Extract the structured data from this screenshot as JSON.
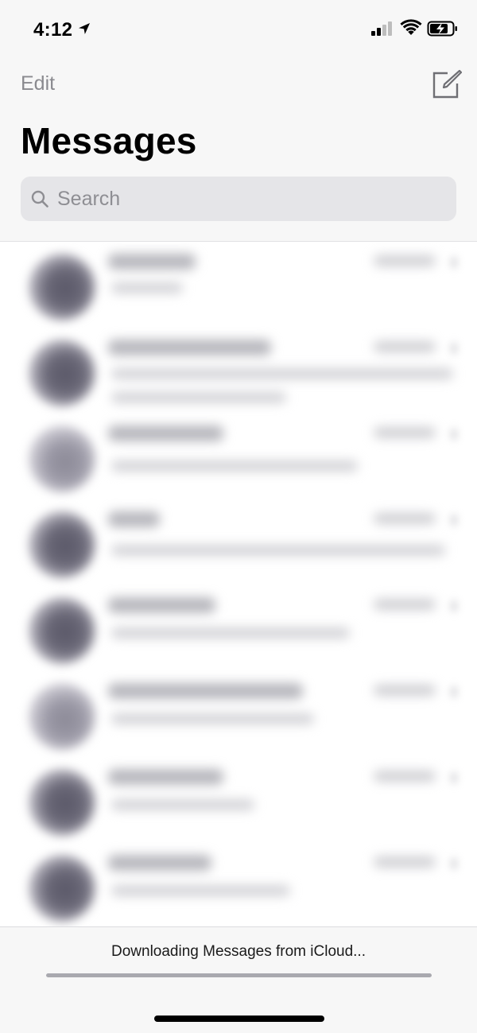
{
  "status_bar": {
    "time": "4:12",
    "icons": [
      "location-arrow-icon",
      "cellular-signal-icon",
      "wifi-icon",
      "battery-charging-icon"
    ]
  },
  "nav": {
    "edit_label": "Edit",
    "compose_icon": "compose-icon"
  },
  "header": {
    "title": "Messages"
  },
  "search": {
    "placeholder": "Search",
    "icon": "search-icon"
  },
  "footer": {
    "status_text": "Downloading Messages from iCloud...",
    "progress": 1.0
  },
  "colors": {
    "background": "#ffffff",
    "header_bg": "#f7f7f7",
    "search_bg": "#e5e5e8",
    "muted_text": "#8e8e93",
    "title_text": "#000000"
  }
}
